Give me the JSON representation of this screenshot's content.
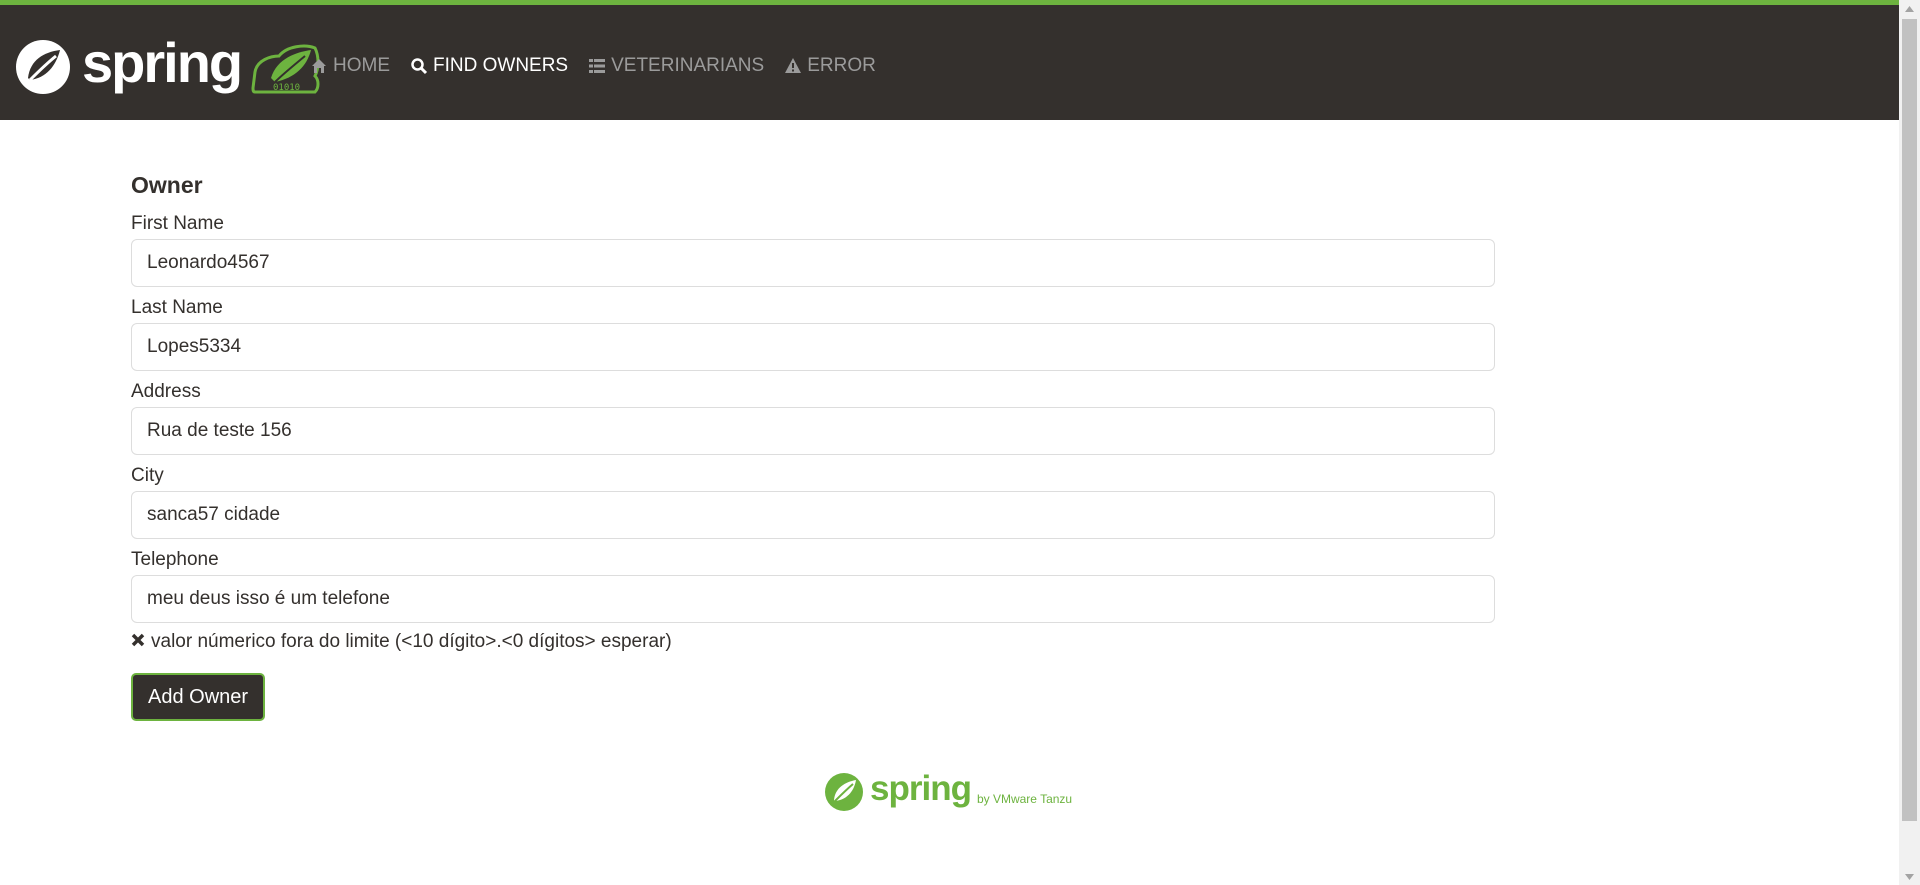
{
  "header": {
    "logo_text": "spring",
    "nav": [
      {
        "label": "HOME",
        "icon": "home-icon",
        "active": false
      },
      {
        "label": "FIND OWNERS",
        "icon": "search-icon",
        "active": true
      },
      {
        "label": "VETERINARIANS",
        "icon": "list-icon",
        "active": false
      },
      {
        "label": "ERROR",
        "icon": "warning-icon",
        "active": false
      }
    ]
  },
  "form": {
    "title": "Owner",
    "fields": [
      {
        "label": "First Name",
        "value": "Leonardo4567"
      },
      {
        "label": "Last Name",
        "value": "Lopes5334"
      },
      {
        "label": "Address",
        "value": "Rua de teste 156"
      },
      {
        "label": "City",
        "value": "sanca57 cidade"
      },
      {
        "label": "Telephone",
        "value": "meu deus isso é um telefone"
      }
    ],
    "telephone_error": "valor númerico fora do limite (<10 dígito>.<0 dígitos> esperar)",
    "submit_label": "Add Owner"
  },
  "footer": {
    "logo_text": "spring",
    "byline": "by VMware Tanzu"
  },
  "colors": {
    "brand_green": "#6db33f",
    "header_bg": "#34302d",
    "nav_inactive": "#9b9b9b"
  }
}
